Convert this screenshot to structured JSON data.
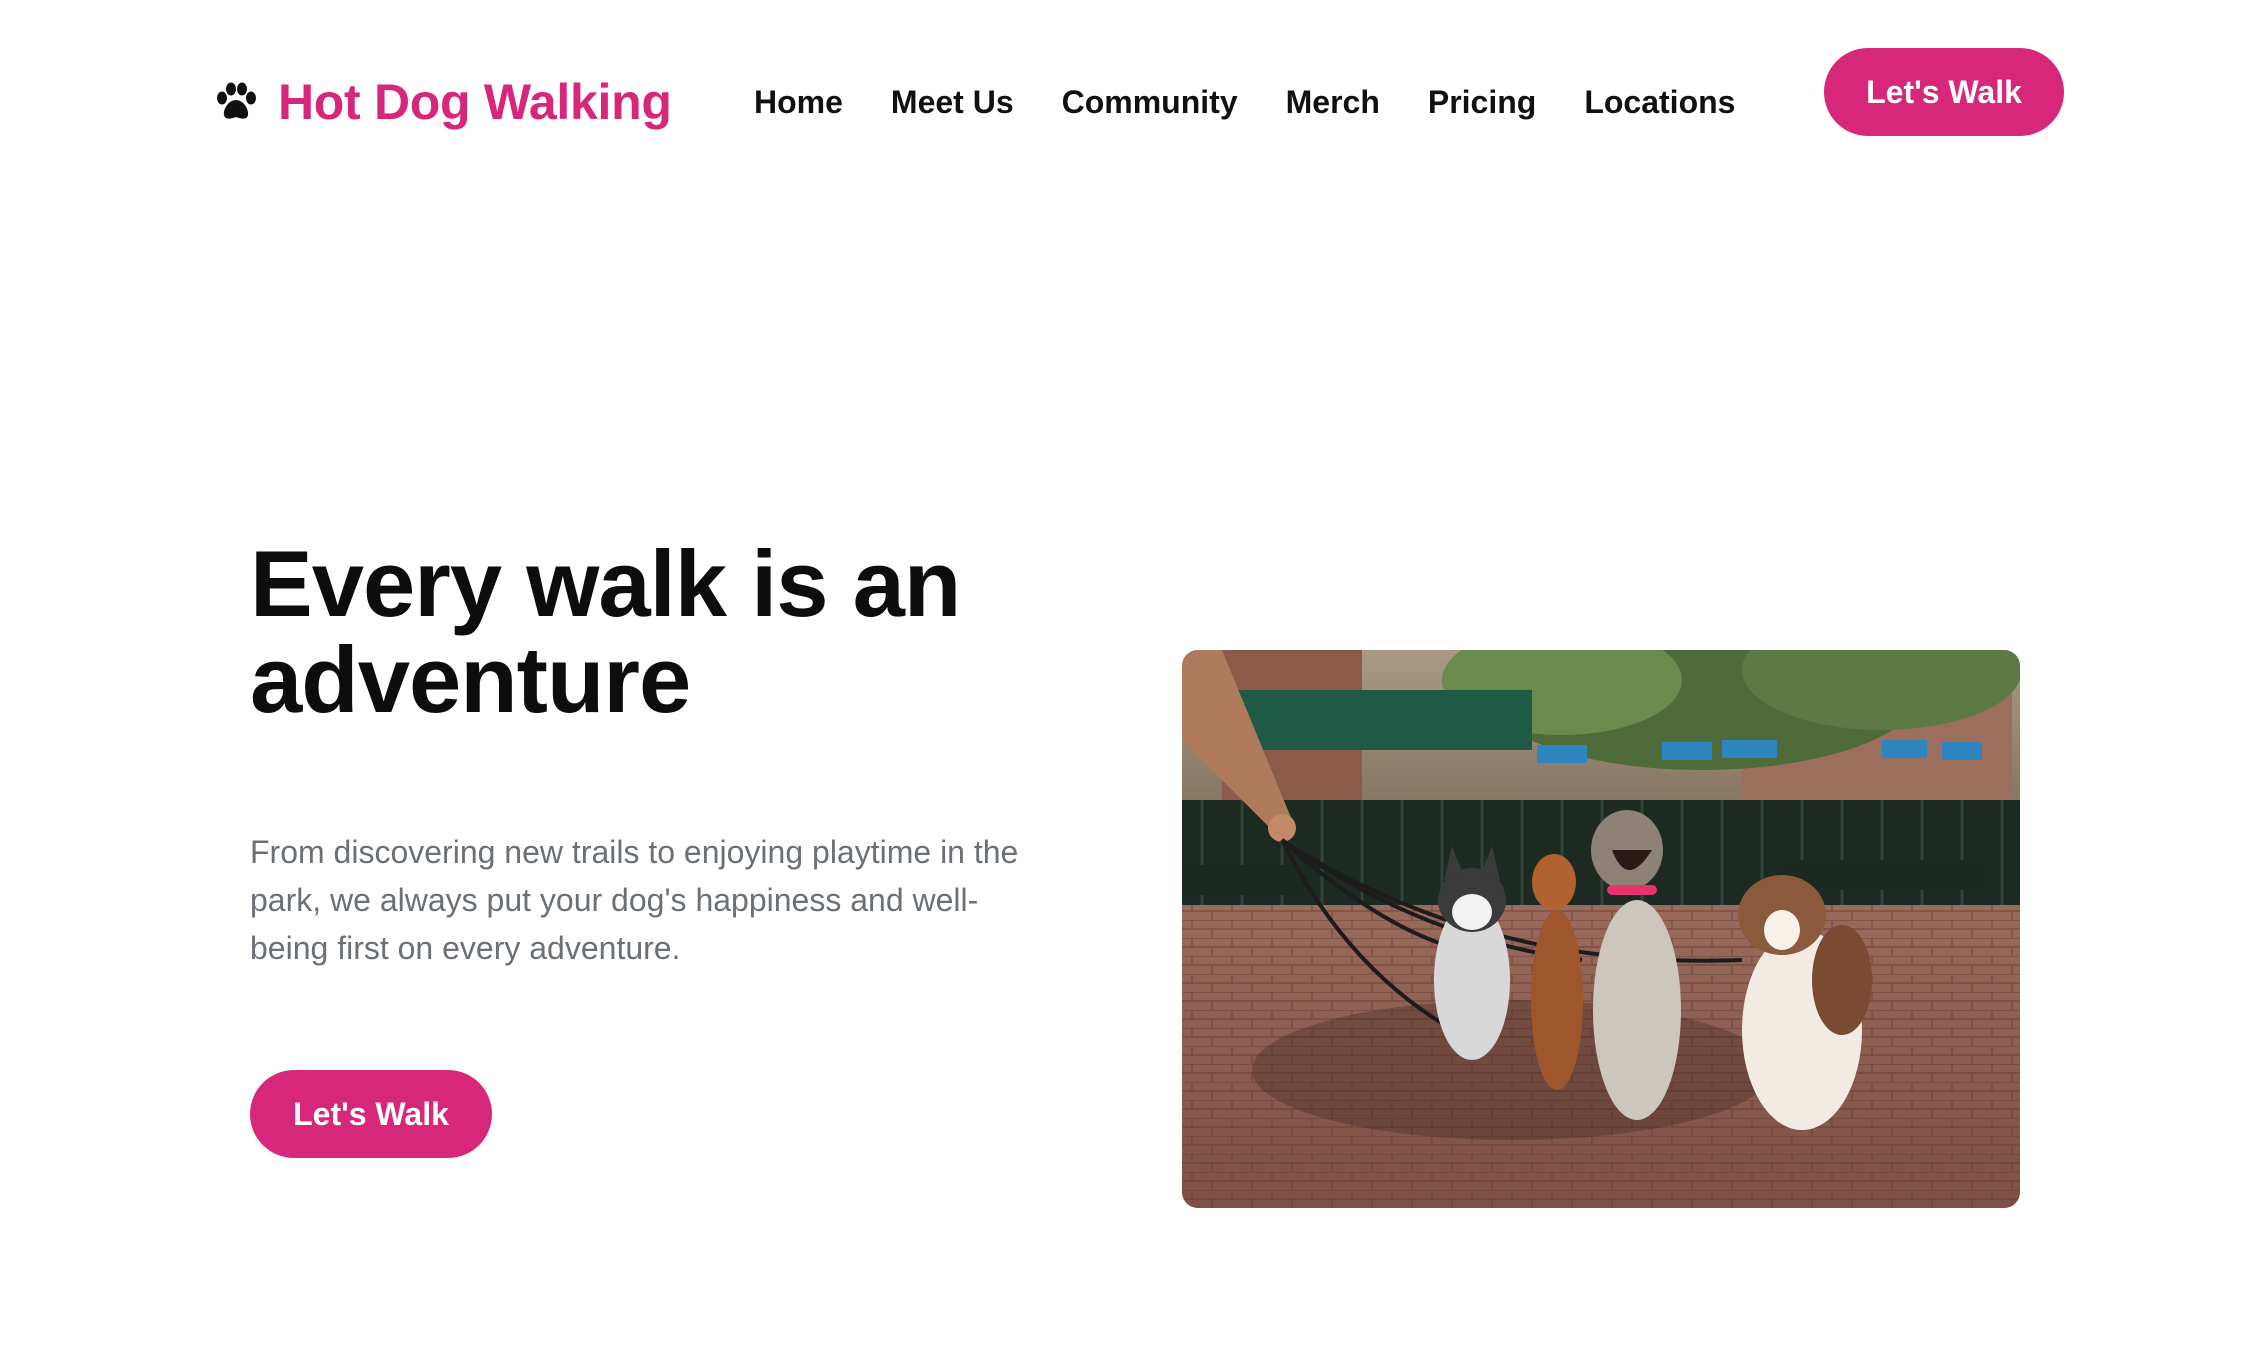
{
  "brand": {
    "icon": "paw-icon",
    "name": "Hot Dog Walking",
    "color": "#d6277a"
  },
  "nav": {
    "items": [
      {
        "label": "Home"
      },
      {
        "label": "Meet Us"
      },
      {
        "label": "Community"
      },
      {
        "label": "Merch"
      },
      {
        "label": "Pricing"
      },
      {
        "label": "Locations"
      }
    ]
  },
  "header": {
    "cta_label": "Let's Walk"
  },
  "hero": {
    "title_line1": "Every walk is an",
    "title_line2": "adventure",
    "description": "From discovering new trails to enjoying playtime in the park, we always put your dog's happiness and well-being first on every adventure.",
    "cta_label": "Let's Walk",
    "photo_alt": "Dogs on leashes sitting in a brick-paved park",
    "accent_color": "#d6277a"
  }
}
